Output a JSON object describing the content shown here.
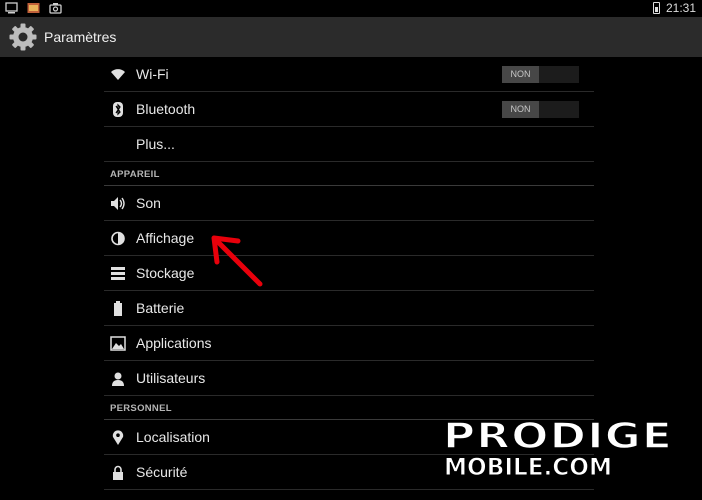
{
  "status_bar": {
    "time": "21:31"
  },
  "action_bar": {
    "title": "Paramètres",
    "icon": "gear-icon"
  },
  "settings": {
    "wifi": {
      "label": "Wi-Fi",
      "toggle": "NON",
      "icon": "wifi-icon"
    },
    "bluetooth": {
      "label": "Bluetooth",
      "toggle": "NON",
      "icon": "bluetooth-icon"
    },
    "more": {
      "label": "Plus..."
    },
    "section_device": "APPAREIL",
    "sound": {
      "label": "Son",
      "icon": "speaker-icon"
    },
    "display": {
      "label": "Affichage",
      "icon": "brightness-icon"
    },
    "storage": {
      "label": "Stockage",
      "icon": "storage-icon"
    },
    "battery": {
      "label": "Batterie",
      "icon": "battery-icon"
    },
    "apps": {
      "label": "Applications",
      "icon": "apps-icon"
    },
    "users": {
      "label": "Utilisateurs",
      "icon": "user-icon"
    },
    "section_personal": "PERSONNEL",
    "location": {
      "label": "Localisation",
      "icon": "location-pin-icon"
    },
    "security": {
      "label": "Sécurité",
      "icon": "lock-icon"
    }
  },
  "watermark": {
    "line1": "PRODIGE",
    "line2": "MOBILE.COM"
  },
  "colors": {
    "annotation_arrow": "#e8000b",
    "action_bar": "#2b2b2b"
  }
}
